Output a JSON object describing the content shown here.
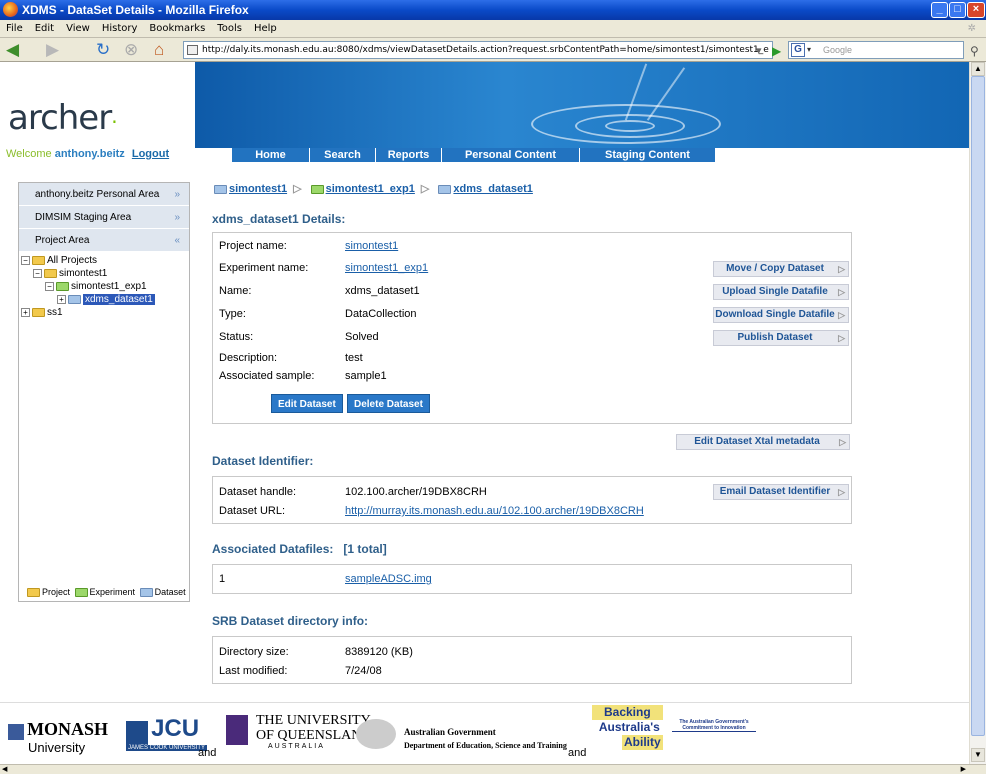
{
  "window": {
    "title": "XDMS - DataSet Details - Mozilla Firefox"
  },
  "menu": [
    "File",
    "Edit",
    "View",
    "History",
    "Bookmarks",
    "Tools",
    "Help"
  ],
  "browser": {
    "url": "http://daly.its.monash.edu.au:8080/xdms/viewDatasetDetails.action?request.srbContentPath=home/simontest1/simontest1_e",
    "search_placeholder": "Google",
    "search_engine_icon": "G"
  },
  "header": {
    "logo_text": "archer",
    "welcome_prefix": "Welcome",
    "user": "anthony.beitz",
    "logout": "Logout",
    "nav": [
      "Home",
      "Search",
      "Reports",
      "Personal Content Transfer",
      "Staging Content Transfer"
    ]
  },
  "sidebar": {
    "sections": [
      "anthony.beitz Personal Area",
      "DIMSIM Staging Area",
      "Project Area"
    ],
    "tree": {
      "root": "All Projects",
      "project": "simontest1",
      "experiment": "simontest1_exp1",
      "dataset": "xdms_dataset1",
      "other": "ss1"
    },
    "legend": {
      "project": "Project",
      "experiment": "Experiment",
      "dataset": "Dataset"
    }
  },
  "breadcrumb": [
    "simontest1",
    "simontest1_exp1",
    "xdms_dataset1"
  ],
  "details": {
    "heading": "xdms_dataset1 Details:",
    "labels": {
      "project": "Project name:",
      "experiment": "Experiment name:",
      "name": "Name:",
      "type": "Type:",
      "status": "Status:",
      "description": "Description:",
      "sample": "Associated sample:"
    },
    "values": {
      "project": "simontest1",
      "experiment": "simontest1_exp1",
      "name": "xdms_dataset1",
      "type": "DataCollection",
      "status": "Solved",
      "description": "test",
      "sample": "sample1"
    },
    "side_buttons": [
      "Move / Copy Dataset",
      "Upload Single Datafile",
      "Download Single Datafile",
      "Publish Dataset"
    ],
    "edit_button": "Edit Dataset",
    "delete_button": "Delete Dataset",
    "xtal_button": "Edit Dataset Xtal metadata"
  },
  "identifier": {
    "heading": "Dataset Identifier:",
    "handle_label": "Dataset handle:",
    "handle": "102.100.archer/19DBX8CRH",
    "url_label": "Dataset URL:",
    "url": "http://murray.its.monash.edu.au/102.100.archer/19DBX8CRH",
    "email_button": "Email Dataset Identifier"
  },
  "datafiles": {
    "heading": "Associated Datafiles:",
    "total": "[1 total]",
    "index": "1",
    "file": "sampleADSC.img"
  },
  "srb": {
    "heading": "SRB Dataset directory info:",
    "size_label": "Directory size:",
    "size": "8389120 (KB)",
    "modified_label": "Last modified:",
    "modified": "7/24/08"
  },
  "footer": {
    "monash": "MONASH",
    "monash_sub": "University",
    "jcu": "JCU",
    "jcu_sub": "JAMES COOK UNIVERSITY",
    "uq_line1": "THE UNIVERSITY",
    "uq_line2": "OF QUEENSLAND",
    "uq_sub": "AUSTRALIA",
    "and": "and",
    "gov": "Australian Government",
    "dept": "Department of Education, Science and Training",
    "backing1": "Backing",
    "backing2": "Australia's",
    "backing3": "Ability",
    "commitment": "The Australian Government's Commitment to Innovation"
  }
}
